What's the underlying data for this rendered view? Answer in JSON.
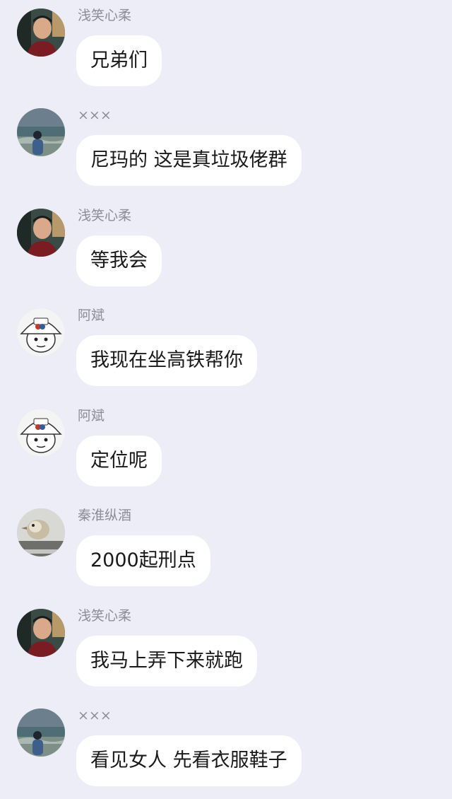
{
  "messages": [
    {
      "sender": "浅笑心柔",
      "text": "兄弟们",
      "avatar": "portrait-man-avatar"
    },
    {
      "sender": "×××",
      "text": "尼玛的 这是真垃圾佬群",
      "avatar": "seaside-figure-avatar"
    },
    {
      "sender": "浅笑心柔",
      "text": "等我会",
      "avatar": "portrait-man-avatar"
    },
    {
      "sender": "阿斌",
      "text": "我现在坐高铁帮你",
      "avatar": "cartoon-cap-avatar"
    },
    {
      "sender": "阿斌",
      "text": "定位呢",
      "avatar": "cartoon-cap-avatar"
    },
    {
      "sender": "秦淮纵酒",
      "text": "2000起刑点",
      "avatar": "bird-photo-avatar"
    },
    {
      "sender": "浅笑心柔",
      "text": "我马上弄下来就跑",
      "avatar": "portrait-man-avatar"
    },
    {
      "sender": "×××",
      "text": "看见女人  先看衣服鞋子",
      "avatar": "seaside-figure-avatar"
    }
  ],
  "colors": {
    "background": "#ecedf7",
    "bubble": "#ffffff",
    "sender_name": "#8c8d96",
    "text": "#1a1a1a"
  }
}
